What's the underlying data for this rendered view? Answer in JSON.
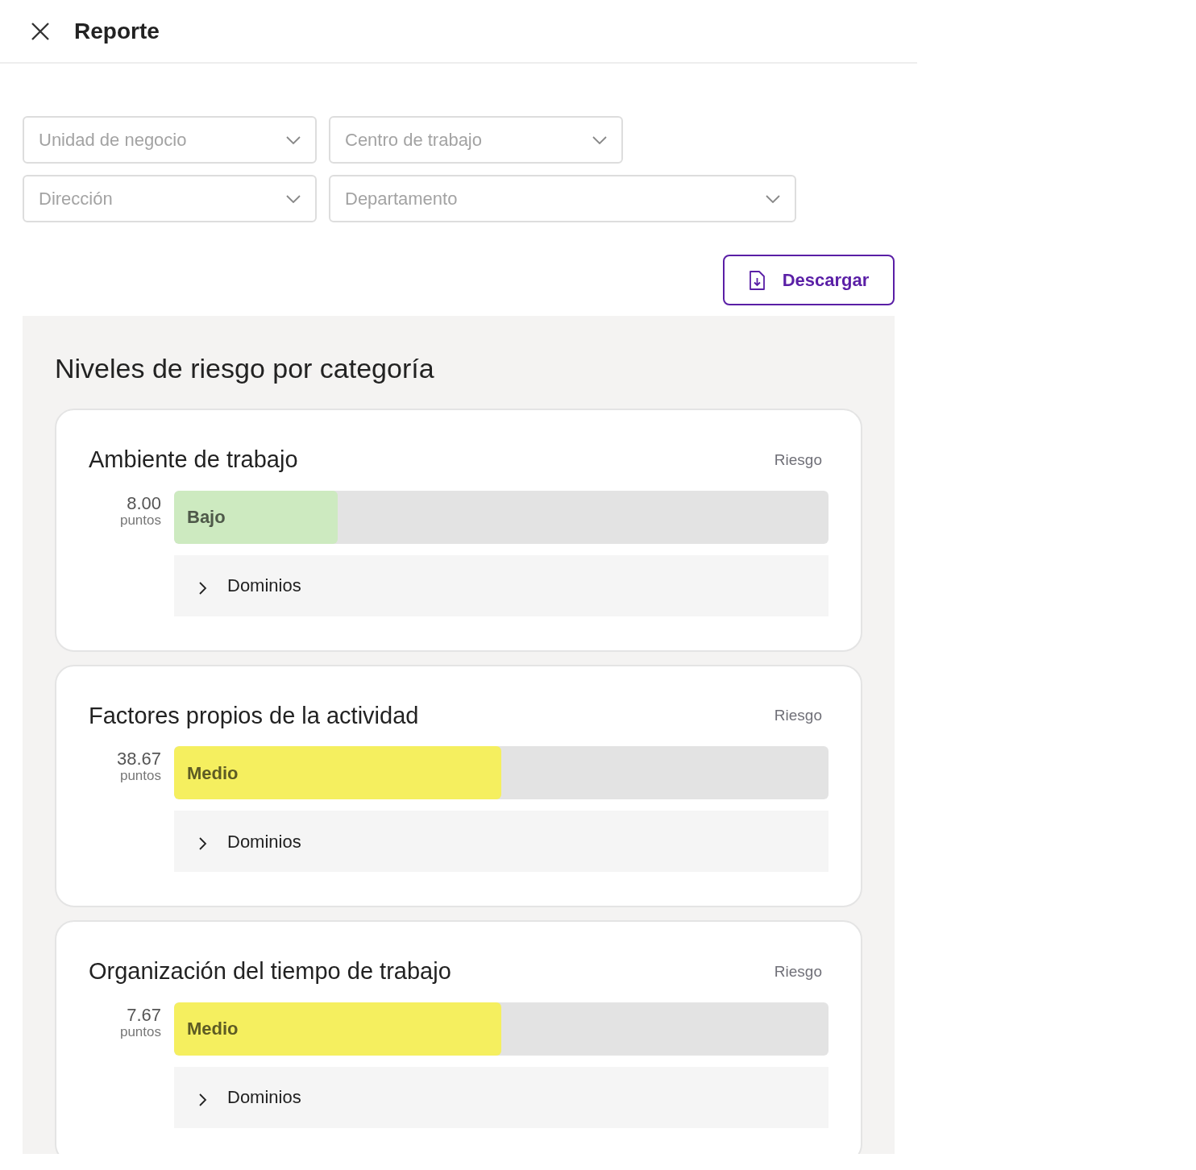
{
  "header": {
    "title": "Reporte"
  },
  "filters": [
    {
      "placeholder": "Unidad de negocio"
    },
    {
      "placeholder": "Centro de trabajo"
    },
    {
      "placeholder": "Dirección"
    },
    {
      "placeholder": "Departamento"
    }
  ],
  "download_button": {
    "label": "Descargar"
  },
  "section": {
    "title": "Niveles de riesgo por categoría",
    "categories": [
      {
        "title": "Ambiente de trabajo",
        "risk_header": "Riesgo",
        "score": "8.00",
        "unit": "puntos",
        "risk_label": "Bajo",
        "color": "#cdeac0",
        "level": 0.25,
        "domains": {
          "label": "Dominios",
          "expanded": false
        }
      },
      {
        "title": "Factores propios de la actividad",
        "risk_header": "Riesgo",
        "score": "38.67",
        "unit": "puntos",
        "risk_label": "Medio",
        "color": "#f5ef5f",
        "level": 0.5,
        "domains": {
          "label": "Dominios",
          "expanded": false
        }
      },
      {
        "title": "Organización del tiempo de trabajo",
        "risk_header": "Riesgo",
        "score": "7.67",
        "unit": "puntos",
        "risk_label": "Medio",
        "color": "#f5ef5f",
        "level": 0.5,
        "domains": {
          "label": "Dominios",
          "expanded": false
        }
      }
    ]
  }
}
